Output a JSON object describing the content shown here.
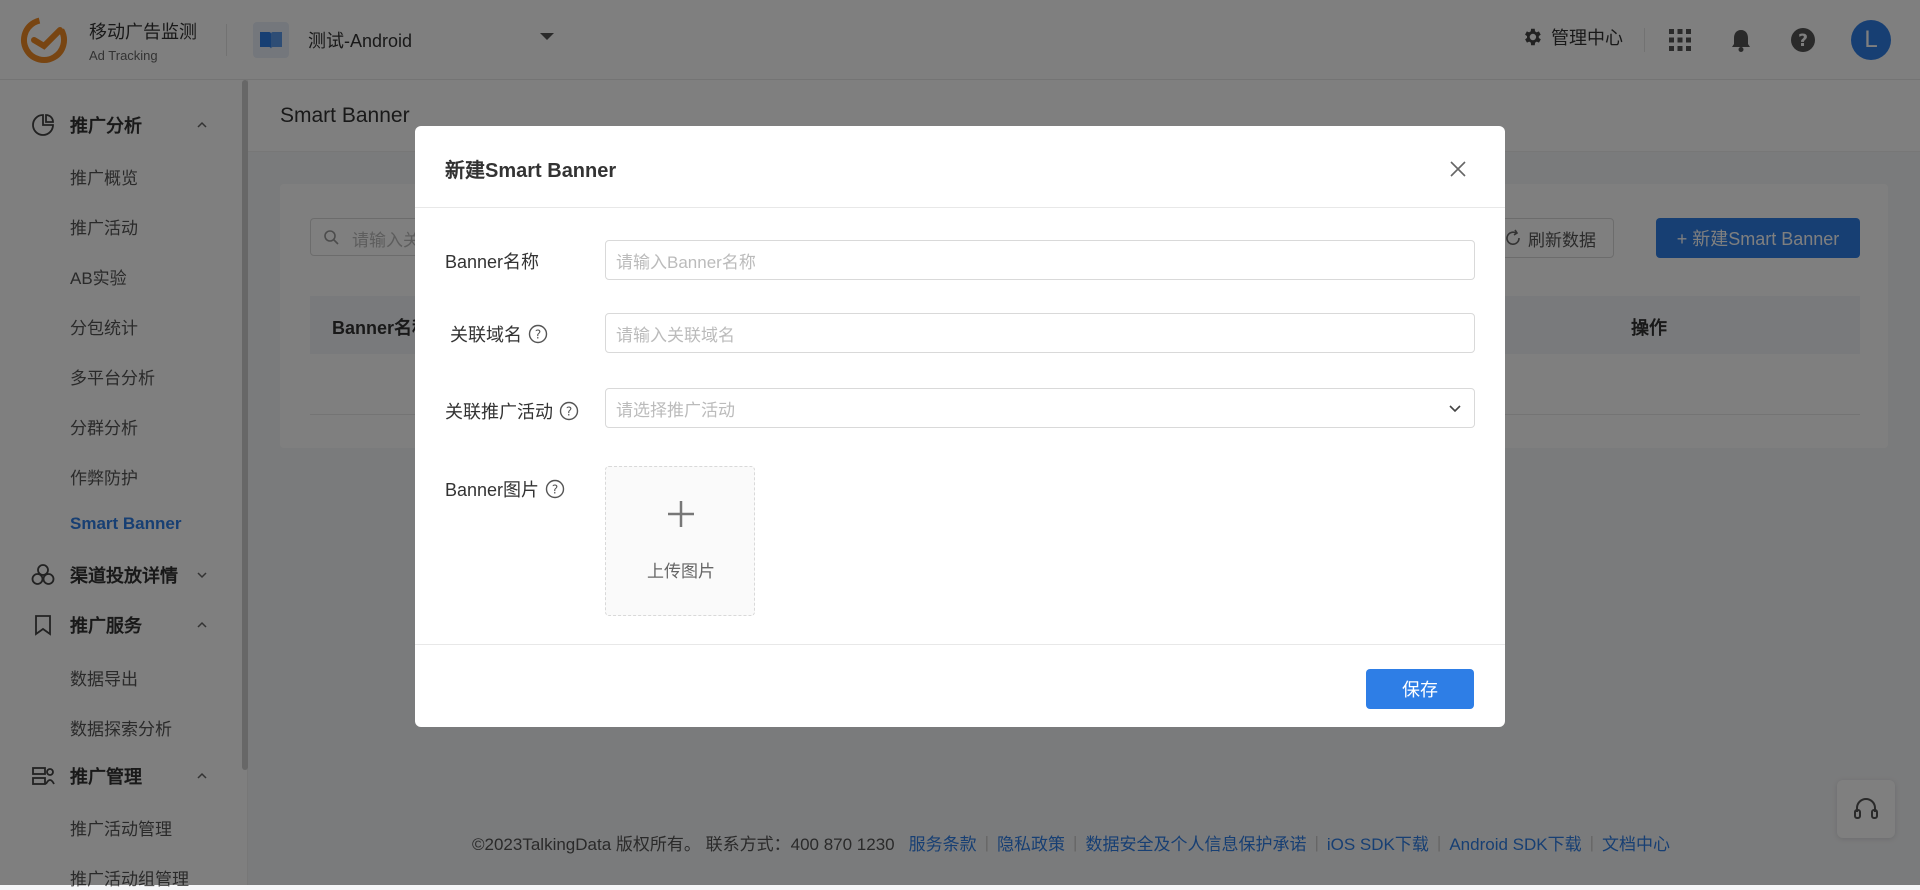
{
  "header": {
    "brand_name": "移动广告监测",
    "brand_sub": "Ad Tracking",
    "app_name": "测试-Android",
    "management_label": "管理中心",
    "avatar_letter": "L",
    "icons": [
      "gear-icon",
      "apps-grid-icon",
      "bell-icon",
      "help-icon"
    ]
  },
  "sidebar": {
    "groups": [
      {
        "label": "推广分析",
        "expanded": true,
        "items": [
          "推广概览",
          "推广活动",
          "AB实验",
          "分包统计",
          "多平台分析",
          "分群分析",
          "作弊防护",
          "Smart Banner"
        ]
      },
      {
        "label": "渠道投放详情",
        "expanded": false,
        "items": []
      },
      {
        "label": "推广服务",
        "expanded": true,
        "items": [
          "数据导出",
          "数据探索分析"
        ]
      },
      {
        "label": "推广管理",
        "expanded": true,
        "items": [
          "推广活动管理",
          "推广活动组管理"
        ]
      }
    ],
    "active_item": "Smart Banner"
  },
  "main": {
    "page_title": "Smart Banner",
    "search_placeholder": "请输入关",
    "refresh_label": "刷新数据",
    "new_button_label": "+ 新建Smart Banner",
    "table_headers": [
      "Banner名称",
      "操作"
    ]
  },
  "footer": {
    "copyright": "©2023TalkingData 版权所有。 联系方式：400 870 1230",
    "links": [
      "服务条款",
      "隐私政策",
      "数据安全及个人信息保护承诺",
      "iOS SDK下载",
      "Android SDK下载",
      "文档中心"
    ]
  },
  "modal": {
    "title": "新建Smart Banner",
    "fields": {
      "banner_name": {
        "label": "Banner名称",
        "placeholder": "请输入Banner名称"
      },
      "domain": {
        "label": "关联域名",
        "placeholder": "请输入关联域名"
      },
      "campaign": {
        "label": "关联推广活动",
        "placeholder": "请选择推广活动"
      },
      "image": {
        "label": "Banner图片",
        "upload_label": "上传图片"
      }
    },
    "save_label": "保存"
  },
  "colors": {
    "accent": "#2e7ee6",
    "overlay": "rgba(0,0,0,0.5)"
  }
}
